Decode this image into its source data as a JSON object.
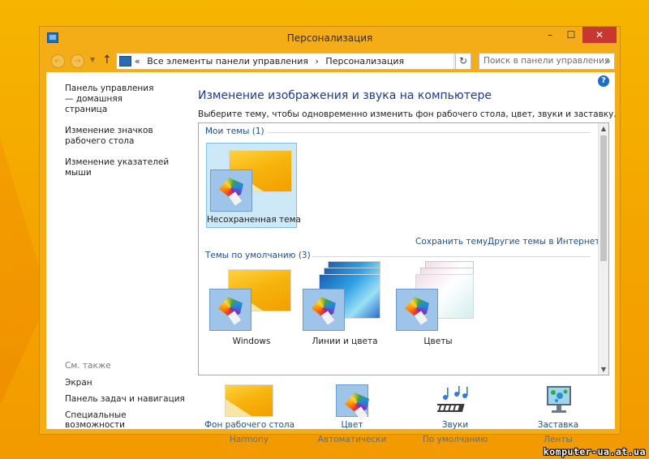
{
  "window": {
    "title": "Персонализация",
    "minimize_glyph": "–",
    "maximize_glyph": "☐",
    "close_glyph": "✕"
  },
  "navbar": {
    "back_glyph": "←",
    "forward_glyph": "→",
    "dropdown_glyph": "▼",
    "up_glyph": "↑",
    "address_chevron": "«",
    "address_path": [
      "Все элементы панели управления",
      "Персонализация"
    ],
    "address_separator": "›",
    "address_dropdown_glyph": "⌄",
    "refresh_glyph": "↻",
    "search_placeholder": "Поиск в панели управления",
    "search_glyph": "⌕"
  },
  "left_pane": {
    "links": [
      "Панель управления — домашняя страница",
      "Изменение значков рабочего стола",
      "Изменение указателей мыши"
    ],
    "see_also_heading": "См. также",
    "see_also_links": [
      "Экран",
      "Панель задач и навигация",
      "Специальные возможности"
    ]
  },
  "main": {
    "help_glyph": "?",
    "title": "Изменение изображения и звука на компьютере",
    "description": "Выберите тему, чтобы одновременно изменить фон рабочего стола, цвет, звуки и заставку.",
    "my_themes_heading": "Мои темы (1)",
    "my_themes": [
      {
        "label": "Несохраненная тема",
        "selected": true
      }
    ],
    "save_theme_link": "Сохранить тему",
    "more_themes_link": "Другие темы в Интернете",
    "default_themes_heading": "Темы по умолчанию (3)",
    "default_themes": [
      {
        "label": "Windows"
      },
      {
        "label": "Линии и цвета"
      },
      {
        "label": "Цветы"
      }
    ],
    "scroll_up_glyph": "▲",
    "scroll_down_glyph": "▼"
  },
  "bottom_bar": [
    {
      "label": "Фон рабочего стола",
      "value": "Harmony",
      "icon": "desktop-background-icon"
    },
    {
      "label": "Цвет",
      "value": "Автоматически",
      "icon": "color-palette-icon"
    },
    {
      "label": "Звуки",
      "value": "По умолчанию",
      "icon": "sounds-icon"
    },
    {
      "label": "Заставка",
      "value": "Ленты",
      "icon": "screensaver-icon"
    }
  ],
  "watermark": "komputer-ua.at.ua",
  "colors": {
    "window_frame": "#f4ad16",
    "close_button": "#c7372f",
    "link_blue": "#1d4f91",
    "selection": "#cde8f7"
  }
}
